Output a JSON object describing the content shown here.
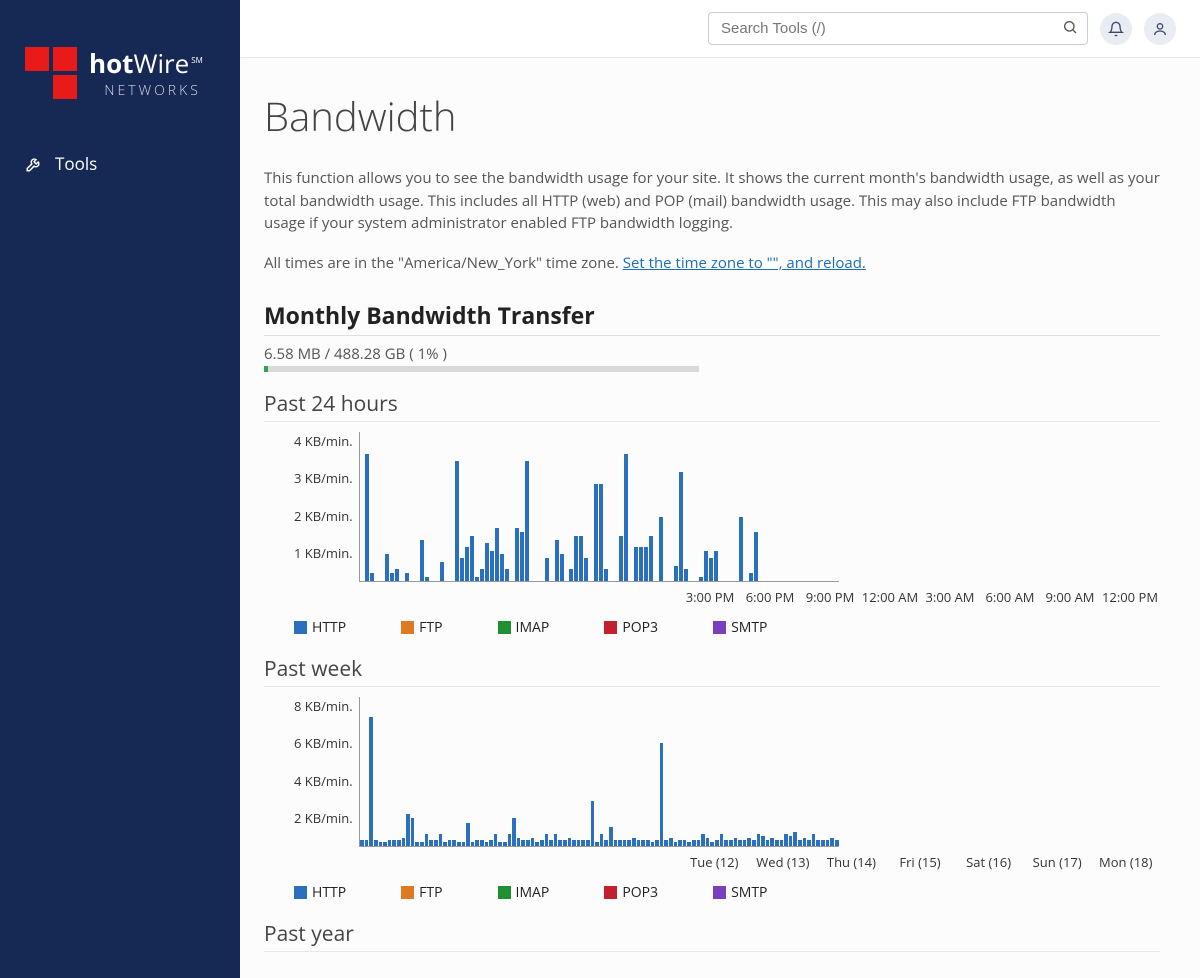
{
  "brand": {
    "name_bold": "hot",
    "name_rest": "Wire",
    "sub": "NETWORKS",
    "sm": "SM"
  },
  "sidebar": {
    "items": [
      {
        "label": "Tools"
      }
    ]
  },
  "search": {
    "placeholder": "Search Tools (/)"
  },
  "page": {
    "title": "Bandwidth",
    "description": "This function allows you to see the bandwidth usage for your site. It shows the current month's bandwidth usage, as well as your total bandwidth usage. This includes all HTTP (web) and POP (mail) bandwidth usage. This may also include FTP bandwidth usage if your system administrator enabled FTP bandwidth logging.",
    "tz_prefix": "All times are in the \"America/New_York\" time zone. ",
    "tz_link": "Set the time zone to \"\", and reload."
  },
  "monthly": {
    "title": "Monthly Bandwidth Transfer",
    "label": "6.58 MB / 488.28 GB ( 1% )",
    "percent": 1
  },
  "legend": [
    {
      "label": "HTTP",
      "color": "#2b6fbf"
    },
    {
      "label": "FTP",
      "color": "#e07a1f"
    },
    {
      "label": "IMAP",
      "color": "#1f8f2f"
    },
    {
      "label": "POP3",
      "color": "#c21f2f"
    },
    {
      "label": "SMTP",
      "color": "#7a3fbf"
    }
  ],
  "charts": {
    "past24": {
      "title": "Past 24 hours",
      "ylabel_suffix": " KB/min.",
      "ymax": 4,
      "yticks": [
        4,
        3,
        2,
        1
      ],
      "xlabels": [
        "3:00 PM",
        "6:00 PM",
        "9:00 PM",
        "12:00 AM",
        "3:00 AM",
        "6:00 AM",
        "9:00 AM",
        "12:00 PM"
      ]
    },
    "pastweek": {
      "title": "Past week",
      "ylabel_suffix": " KB/min.",
      "ymax": 8,
      "yticks": [
        8,
        6,
        4,
        2
      ],
      "xlabels": [
        "Tue (12)",
        "Wed (13)",
        "Thu (14)",
        "Fri (15)",
        "Sat (16)",
        "Sun (17)",
        "Mon (18)"
      ]
    },
    "pastyear": {
      "title": "Past year"
    }
  },
  "chart_data": [
    {
      "id": "past24",
      "type": "bar",
      "title": "Past 24 hours",
      "ylabel": "KB/min.",
      "ylim": [
        0,
        4
      ],
      "x_unit": "hour",
      "x_tick_labels": [
        "3:00 PM",
        "6:00 PM",
        "9:00 PM",
        "12:00 AM",
        "3:00 AM",
        "6:00 AM",
        "9:00 AM",
        "12:00 PM"
      ],
      "series": [
        {
          "name": "HTTP",
          "color": "#2b6fbf",
          "values": [
            0,
            3.4,
            0.2,
            0,
            0,
            0.7,
            0.2,
            0.3,
            0,
            0.2,
            0,
            0,
            1.1,
            0.1,
            0,
            0,
            0.5,
            0,
            0,
            3.2,
            0.6,
            0.9,
            1.2,
            0.1,
            0.3,
            1.0,
            0.8,
            1.4,
            0.7,
            0.3,
            0,
            1.4,
            1.3,
            3.2,
            0,
            0,
            0,
            0.6,
            0,
            1.1,
            0.7,
            0,
            0.3,
            1.2,
            1.2,
            0.6,
            0,
            2.6,
            2.6,
            0.3,
            0,
            0,
            1.2,
            3.4,
            0,
            0.9,
            0.9,
            0.9,
            1.2,
            0,
            1.7,
            0,
            0,
            0.4,
            2.9,
            0.3,
            0,
            0,
            0.1,
            0.8,
            0.6,
            0.8,
            0,
            0,
            0,
            0,
            1.7,
            0,
            0.2,
            1.3,
            0,
            0,
            0,
            0,
            0,
            0,
            0,
            0,
            0,
            0,
            0,
            0,
            0,
            0,
            0,
            0
          ]
        },
        {
          "name": "FTP",
          "color": "#e07a1f",
          "values": []
        },
        {
          "name": "IMAP",
          "color": "#1f8f2f",
          "values": []
        },
        {
          "name": "POP3",
          "color": "#c21f2f",
          "values": []
        },
        {
          "name": "SMTP",
          "color": "#7a3fbf",
          "values": []
        }
      ]
    },
    {
      "id": "pastweek",
      "type": "bar",
      "title": "Past week",
      "ylabel": "KB/min.",
      "ylim": [
        0,
        8
      ],
      "x_unit": "day",
      "x_tick_labels": [
        "Tue (12)",
        "Wed (13)",
        "Thu (14)",
        "Fri (15)",
        "Sat (16)",
        "Sun (17)",
        "Mon (18)"
      ],
      "series": [
        {
          "name": "HTTP",
          "color": "#2b6fbf",
          "values": [
            0.3,
            0.3,
            6.9,
            0.3,
            0.2,
            0.2,
            0.3,
            0.3,
            0.3,
            0.4,
            1.7,
            1.5,
            0.2,
            0.2,
            0.6,
            0.3,
            0.3,
            0.6,
            0.2,
            0.3,
            0.3,
            0.2,
            0.2,
            1.2,
            0.2,
            0.3,
            0.3,
            0.2,
            0.3,
            0.6,
            0.2,
            0.2,
            0.6,
            1.5,
            0.4,
            0.3,
            0.3,
            0.4,
            0.2,
            0.3,
            0.6,
            0.3,
            0.6,
            0.3,
            0.3,
            0.4,
            0.3,
            0.3,
            0.3,
            0.3,
            2.4,
            0.2,
            0.6,
            0.3,
            1.0,
            0.3,
            0.3,
            0.3,
            0.3,
            0.4,
            0.3,
            0.3,
            0.3,
            0.2,
            0.3,
            5.5,
            0.3,
            0.4,
            0.2,
            0.3,
            0.3,
            0.2,
            0.3,
            0.3,
            0.6,
            0.4,
            0.2,
            0.3,
            0.6,
            0.3,
            0.3,
            0.4,
            0.3,
            0.3,
            0.4,
            0.3,
            0.6,
            0.5,
            0.3,
            0.4,
            0.3,
            0.3,
            0.6,
            0.5,
            0.7,
            0.3,
            0.4,
            0.3,
            0.6,
            0.3,
            0.3,
            0.3,
            0.4,
            0.3
          ]
        },
        {
          "name": "FTP",
          "color": "#e07a1f",
          "values": []
        },
        {
          "name": "IMAP",
          "color": "#1f8f2f",
          "values": []
        },
        {
          "name": "POP3",
          "color": "#c21f2f",
          "values": []
        },
        {
          "name": "SMTP",
          "color": "#7a3fbf",
          "values": []
        }
      ]
    }
  ]
}
